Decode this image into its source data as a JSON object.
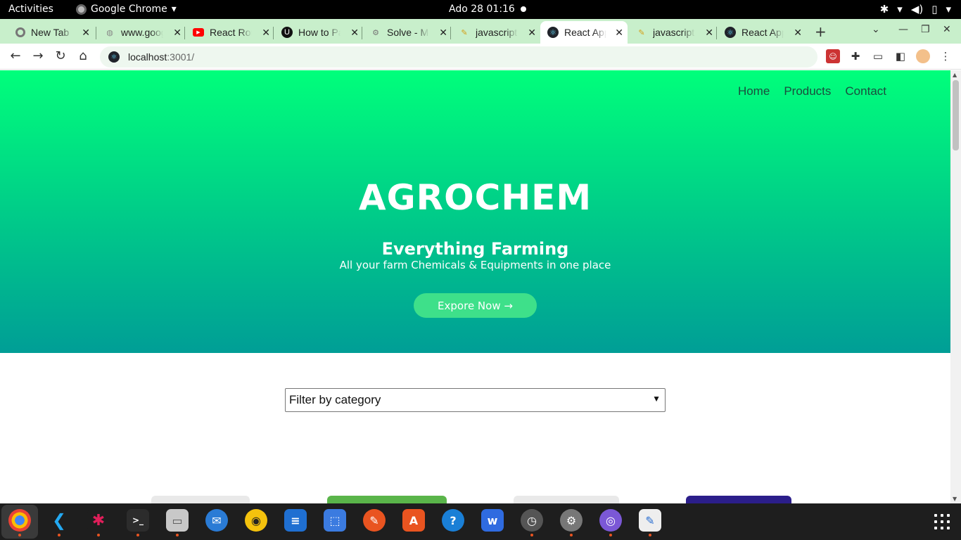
{
  "system_bar": {
    "activities": "Activities",
    "app_name": "Google Chrome",
    "clock": "Ado 28  01:16"
  },
  "tabs": [
    {
      "title": "New Tab",
      "icon": "chrome-icon"
    },
    {
      "title": "www.google",
      "icon": "globe-icon"
    },
    {
      "title": "React Router",
      "icon": "youtube-icon"
    },
    {
      "title": "How to Pass",
      "icon": "udacity-icon"
    },
    {
      "title": "Solve - Mo",
      "icon": "gear-icon"
    },
    {
      "title": "javascript",
      "icon": "pencil-icon"
    },
    {
      "title": "React App",
      "icon": "react-icon",
      "active": true
    },
    {
      "title": "javascript",
      "icon": "pencil-icon"
    },
    {
      "title": "React App",
      "icon": "react-icon"
    }
  ],
  "omnibox": {
    "host": "localhost",
    "path": ":3001/"
  },
  "page": {
    "nav": [
      "Home",
      "Products",
      "Contact"
    ],
    "brand": "AGROCHEM",
    "tagline": "Everything Farming",
    "subtitle": "All your farm Chemicals & Equipments in one place",
    "cta": "Expore Now →",
    "filter_label": "Filter by category"
  },
  "colors": {
    "hero_top": "#00ff7b",
    "hero_bottom": "#009e96",
    "tab_strip": "#c8efcb",
    "cta": "#3ee08a"
  }
}
